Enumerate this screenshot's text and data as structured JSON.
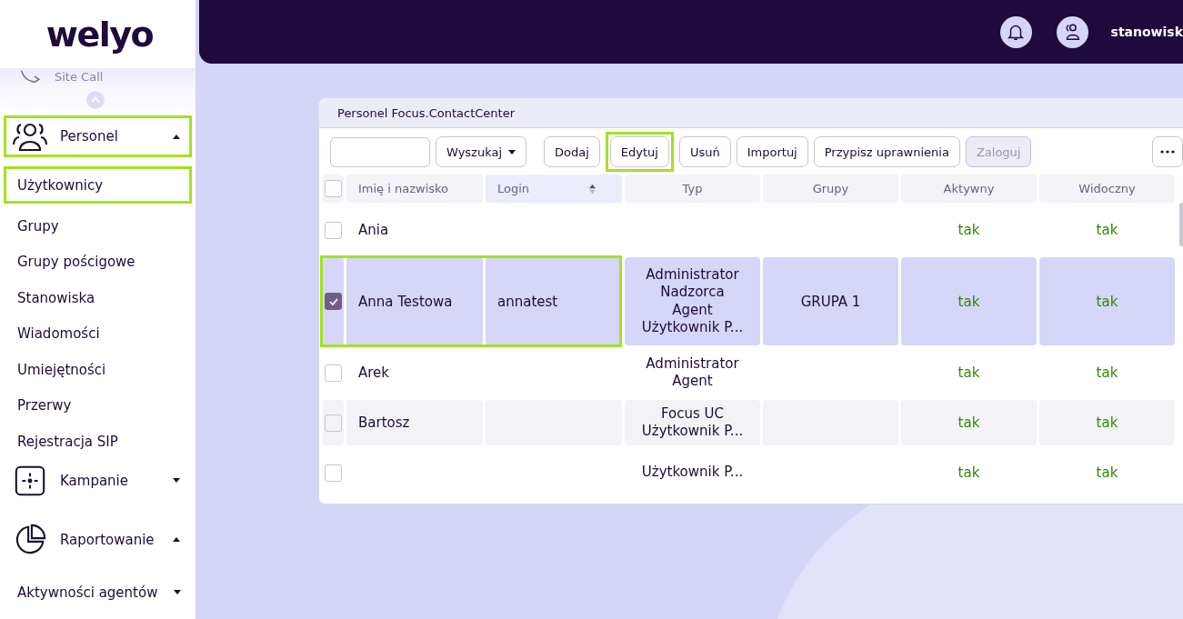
{
  "logo": "welyo",
  "sidebar": {
    "items": [
      {
        "kind": "link",
        "label": "Site Call"
      },
      {
        "kind": "group",
        "label": "Personel",
        "expanded": true,
        "highlighted": true,
        "children": [
          {
            "label": "Użytkownicy",
            "highlighted": true
          },
          {
            "label": "Grupy",
            "highlighted": false
          },
          {
            "label": "Grupy pościgowe",
            "highlighted": false
          },
          {
            "label": "Stanowiska",
            "highlighted": false
          },
          {
            "label": "Wiadomości",
            "highlighted": false
          },
          {
            "label": "Umiejętności",
            "highlighted": false
          },
          {
            "label": "Przerwy",
            "highlighted": false
          },
          {
            "label": "Rejestracja SIP",
            "highlighted": false
          }
        ]
      },
      {
        "kind": "group",
        "label": "Kampanie",
        "expanded": false,
        "highlighted": false
      },
      {
        "kind": "group",
        "label": "Raportowanie",
        "expanded": true,
        "highlighted": false,
        "children": [
          {
            "label": "Aktywności agentów",
            "highlighted": false,
            "expanded": false
          }
        ]
      }
    ]
  },
  "topbar": {
    "user": "stanowisk"
  },
  "panel": {
    "title": "Personel Focus.ContactCenter",
    "buttons": [
      {
        "label": "Wyszukaj",
        "kind": "dropdown",
        "disabled": false,
        "highlighted": false
      },
      {
        "label": "Dodaj",
        "kind": "action",
        "disabled": false,
        "highlighted": false
      },
      {
        "label": "Edytuj",
        "kind": "action",
        "disabled": false,
        "highlighted": true
      },
      {
        "label": "Usuń",
        "kind": "action",
        "disabled": false,
        "highlighted": false
      },
      {
        "label": "Importuj",
        "kind": "action",
        "disabled": false,
        "highlighted": false
      },
      {
        "label": "Przypisz uprawnienia",
        "kind": "action",
        "disabled": false,
        "highlighted": false
      },
      {
        "label": "Zaloguj",
        "kind": "action",
        "disabled": true,
        "highlighted": false
      }
    ],
    "table": {
      "select_all_checked": false,
      "columns": [
        {
          "label": "Imię i nazwisko",
          "sorted": false
        },
        {
          "label": "Login",
          "sorted": true
        },
        {
          "label": "Typ",
          "sorted": false
        },
        {
          "label": "Grupy",
          "sorted": false
        },
        {
          "label": "Aktywny",
          "sorted": false
        },
        {
          "label": "Widoczny",
          "sorted": false
        }
      ],
      "rows": [
        {
          "checked": false,
          "selected": false,
          "hovered": false,
          "highlighted": false,
          "name": "Ania",
          "types": [],
          "active": "tak",
          "visible": "tak"
        },
        {
          "checked": true,
          "selected": true,
          "hovered": false,
          "highlighted": true,
          "name": "Anna Testowa",
          "login": "annatest",
          "types": [
            "Administrator",
            "Nadzorca",
            "Agent",
            "Użytkownik P..."
          ],
          "groups": "GRUPA 1",
          "active": "tak",
          "visible": "tak"
        },
        {
          "checked": false,
          "selected": false,
          "hovered": false,
          "highlighted": false,
          "name": "Arek",
          "types": [
            "Administrator",
            "Agent"
          ],
          "active": "tak",
          "visible": "tak"
        },
        {
          "checked": false,
          "selected": false,
          "hovered": true,
          "highlighted": false,
          "name": "Bartosz",
          "types": [
            "Focus UC",
            "Użytkownik P..."
          ],
          "active": "tak",
          "visible": "tak"
        },
        {
          "checked": false,
          "selected": false,
          "hovered": false,
          "highlighted": false,
          "types": [
            "Użytkownik P..."
          ],
          "active": "tak",
          "visible": "tak"
        }
      ]
    }
  }
}
